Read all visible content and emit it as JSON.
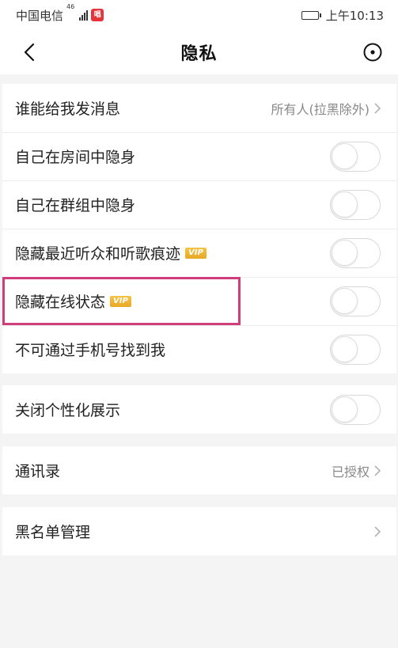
{
  "status_bar": {
    "carrier": "中国电信",
    "network_label": "46",
    "app_badge": "唱",
    "time": "上午10:13"
  },
  "nav": {
    "title": "隐私"
  },
  "groups": {
    "privacy": [
      {
        "label": "谁能给我发消息",
        "value": "所有人(拉黑除外)"
      },
      {
        "label": "自己在房间中隐身",
        "toggle": false
      },
      {
        "label": "自己在群组中隐身",
        "toggle": false
      },
      {
        "label": "隐藏最近听众和听歌痕迹",
        "vip": "VIP",
        "toggle": false
      },
      {
        "label": "隐藏在线状态",
        "vip": "VIP",
        "toggle": false
      },
      {
        "label": "不可通过手机号找到我",
        "toggle": false
      }
    ],
    "personalization": [
      {
        "label": "关闭个性化展示",
        "toggle": false
      }
    ],
    "contacts": [
      {
        "label": "通讯录",
        "value": "已授权"
      }
    ],
    "blacklist": [
      {
        "label": "黑名单管理"
      }
    ]
  },
  "colors": {
    "highlight": "#cf3d7a",
    "vip": "#e8a826"
  }
}
